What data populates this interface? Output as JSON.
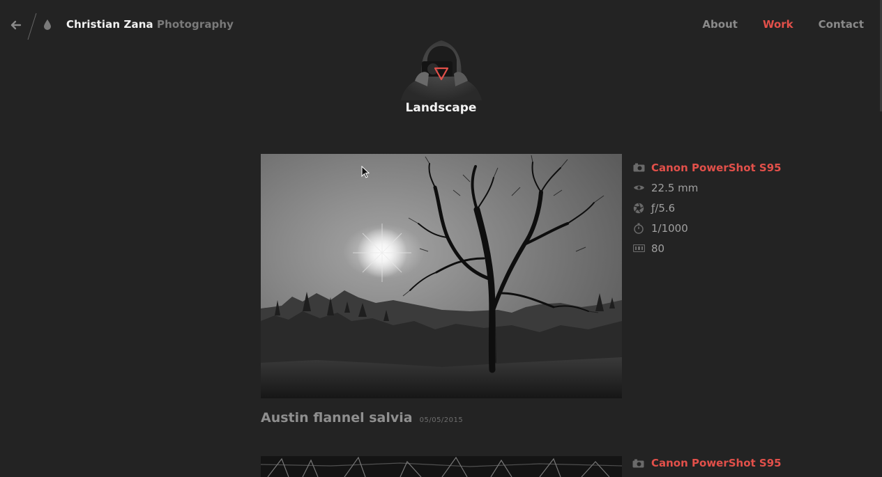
{
  "header": {
    "name": "Christian Zana",
    "subtitle": "Photography",
    "nav": [
      {
        "label": "About",
        "active": false
      },
      {
        "label": "Work",
        "active": true
      },
      {
        "label": "Contact",
        "active": false
      }
    ]
  },
  "page": {
    "category": "Landscape"
  },
  "posts": [
    {
      "title": "Austin flannel salvia",
      "date": "05/05/2015",
      "camera": "Canon PowerShot S95",
      "focal_length": "22.5 mm",
      "aperture": "ƒ/5.6",
      "shutter": "1/1000",
      "iso": "80"
    },
    {
      "camera": "Canon PowerShot S95"
    }
  ],
  "colors": {
    "background": "#232323",
    "accent": "#e2504a",
    "muted": "#8a8a8a"
  },
  "icons": [
    "back-arrow-icon",
    "slash-divider",
    "drop-icon",
    "camera-icon",
    "eye-icon",
    "aperture-icon",
    "stopwatch-icon",
    "iso-icon",
    "mouse-cursor-icon"
  ]
}
